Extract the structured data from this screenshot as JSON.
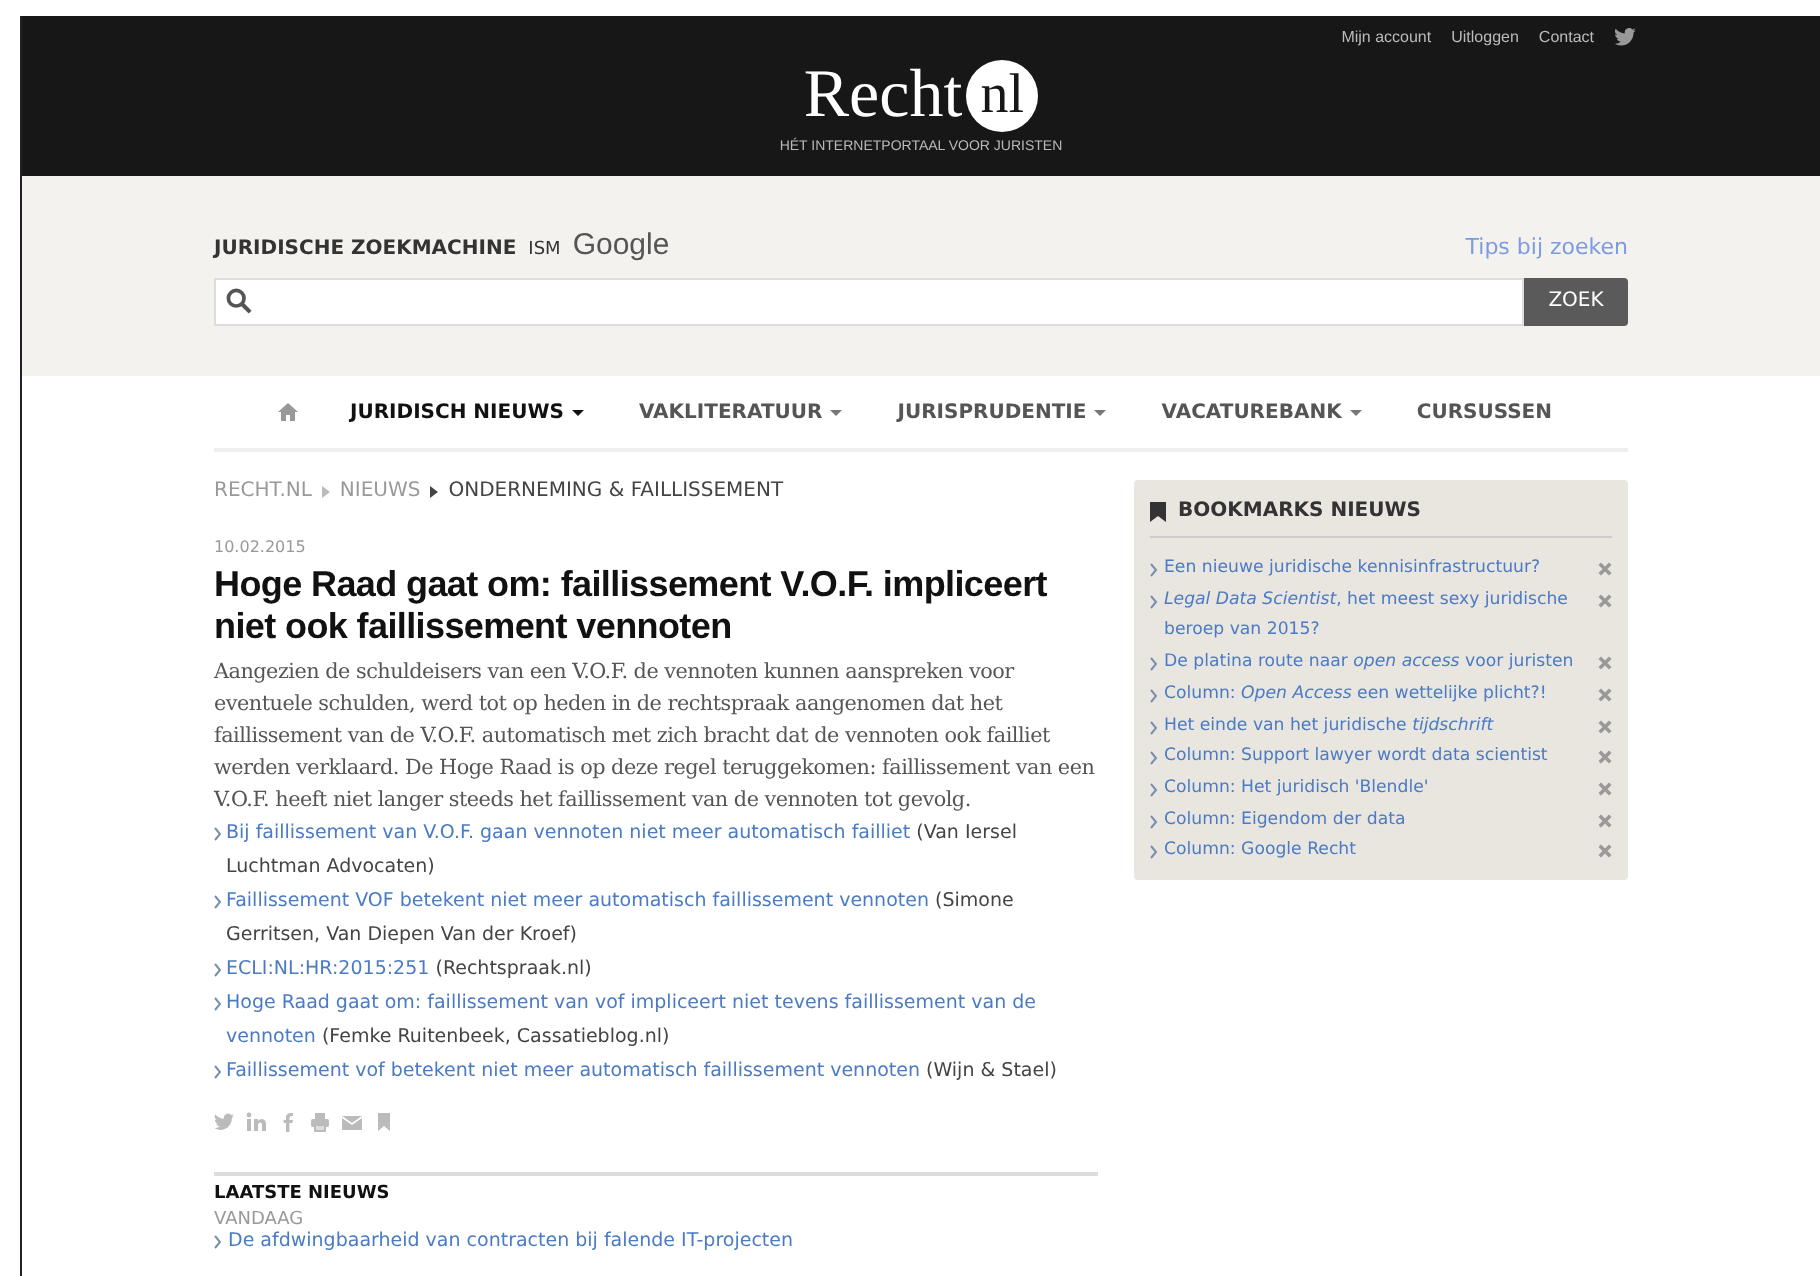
{
  "header": {
    "top_links": [
      "Mijn account",
      "Uitloggen",
      "Contact"
    ],
    "logo_text": "Recht",
    "logo_badge": "nl",
    "tagline": "HÉT INTERNETPORTAAL VOOR JURISTEN"
  },
  "search": {
    "label": "JURIDISCHE ZOEKMACHINE",
    "ism": "ISM",
    "engine": "Google",
    "tips": "Tips bij zoeken",
    "button": "ZOEK"
  },
  "nav": [
    {
      "label": "JURIDISCH NIEUWS",
      "dropdown": true,
      "selected": true
    },
    {
      "label": "VAKLITERATUUR",
      "dropdown": true,
      "selected": false
    },
    {
      "label": "JURISPRUDENTIE",
      "dropdown": true,
      "selected": false
    },
    {
      "label": "VACATUREBANK",
      "dropdown": true,
      "selected": false
    },
    {
      "label": "CURSUSSEN",
      "dropdown": false,
      "selected": false
    }
  ],
  "breadcrumb": [
    "RECHT.NL",
    "NIEUWS",
    "ONDERNEMING & FAILLISSEMENT"
  ],
  "article": {
    "date": "10.02.2015",
    "title": "Hoge Raad gaat om: faillissement V.O.F. impliceert niet ook faillissement vennoten",
    "body": "Aangezien de schuldeisers van een V.O.F. de vennoten kunnen aanspreken voor eventuele schulden, werd tot op heden in de rechtspraak aangenomen dat het faillissement van de V.O.F. automatisch met zich bracht dat de vennoten ook failliet werden verklaard. De Hoge Raad is op deze regel teruggekomen: faillissement van een V.O.F. heeft niet langer steeds het faillissement van de vennoten tot gevolg.",
    "related": [
      {
        "link": "Bij faillissement van V.O.F. gaan vennoten niet meer automatisch failliet",
        "source": "(Van Iersel Luchtman Advocaten)"
      },
      {
        "link": "Faillissement VOF betekent niet meer automatisch faillissement vennoten",
        "source": "(Simone Gerritsen, Van Diepen Van der Kroef)"
      },
      {
        "link": "ECLI:NL:HR:2015:251",
        "source": "(Rechtspraak.nl)"
      },
      {
        "link": "Hoge Raad gaat om: faillissement van vof impliceert niet tevens faillissement van de vennoten",
        "source": "(Femke Ruitenbeek, Cassatieblog.nl)"
      },
      {
        "link": "Faillissement vof betekent niet meer automatisch faillissement vennoten",
        "source": "(Wijn & Stael)"
      }
    ]
  },
  "latest": {
    "title": "LAATSTE NIEUWS",
    "day": "VANDAAG",
    "items": [
      "De afdwingbaarheid van contracten bij falende IT-projecten"
    ]
  },
  "bookmarks": {
    "title": "BOOKMARKS NIEUWS",
    "items": [
      "Een nieuwe juridische kennisinfrastructuur?",
      "*Legal Data Scientist*, het meest sexy juridische beroep van 2015?",
      "De platina route naar *open access* voor juristen",
      "Column: *Open Access* een wettelijke plicht?!",
      "Het einde van het juridische *tijdschrift*",
      "Column: Support lawyer wordt data scientist",
      "Column: Het juridisch 'Blendle'",
      "Column: Eigendom der data",
      "Column: Google Recht"
    ]
  }
}
